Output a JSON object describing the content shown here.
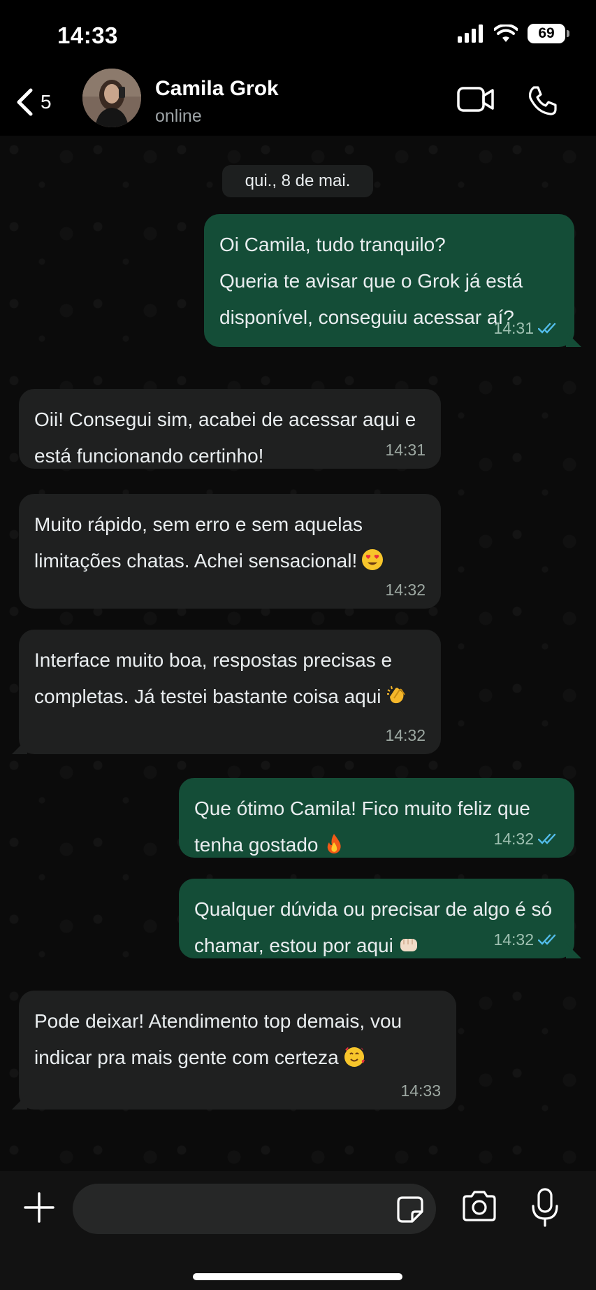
{
  "status_bar": {
    "time": "14:33",
    "battery": "69"
  },
  "header": {
    "back_count": "5",
    "contact_name": "Camila Grok",
    "contact_status": "online"
  },
  "chat": {
    "date": "qui., 8 de mai.",
    "messages": [
      {
        "direction": "outgoing",
        "text": "Oi Camila, tudo tranquilo?\nQueria te avisar que o Grok já está disponível, conseguiu acessar aí?",
        "time": "14:31",
        "read": true
      },
      {
        "direction": "incoming",
        "text": "Oii! Consegui sim, acabei de acessar aqui e está funcionando certinho!",
        "time": "14:31"
      },
      {
        "direction": "incoming",
        "text": "Muito rápido, sem erro e sem aquelas limitações chatas. Achei sensacional!",
        "emoji": "heart-eyes-emoji",
        "time": "14:32"
      },
      {
        "direction": "incoming",
        "text": "Interface muito boa, respostas precisas e completas. Já testei bastante coisa aqui",
        "emoji": "clapping-hands-emoji",
        "time": "14:32"
      },
      {
        "direction": "outgoing",
        "text": "Que ótimo Camila! Fico muito feliz que tenha gostado",
        "emoji": "fire-emoji",
        "time": "14:32",
        "read": true
      },
      {
        "direction": "outgoing",
        "text": "Qualquer dúvida ou precisar de algo é só chamar, estou por aqui",
        "emoji": "fist-bump-emoji",
        "time": "14:32",
        "read": true
      },
      {
        "direction": "incoming",
        "text": "Pode deixar! Atendimento top demais, vou indicar pra mais gente com certeza",
        "emoji": "smiling-face-with-hearts-emoji",
        "time": "14:33"
      }
    ]
  },
  "colors": {
    "outgoing_bubble": "#144d37",
    "incoming_bubble": "#1f2020",
    "read_ticks": "#53bdeb"
  }
}
